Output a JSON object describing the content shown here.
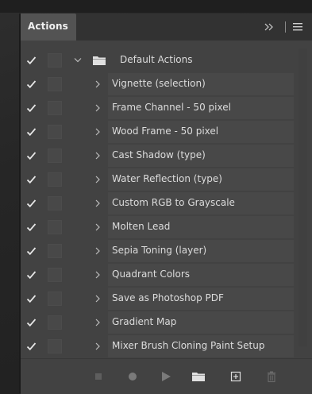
{
  "panel": {
    "tab_label": "Actions",
    "collapse_glyph": "»"
  },
  "folder": {
    "label": "Default Actions",
    "expanded": true,
    "enabled": true,
    "icon": "folder-icon"
  },
  "actions": [
    {
      "label": "Vignette (selection)",
      "enabled": true
    },
    {
      "label": "Frame Channel - 50 pixel",
      "enabled": true
    },
    {
      "label": "Wood Frame - 50 pixel",
      "enabled": true
    },
    {
      "label": "Cast Shadow (type)",
      "enabled": true
    },
    {
      "label": "Water Reflection (type)",
      "enabled": true
    },
    {
      "label": "Custom RGB to Grayscale",
      "enabled": true
    },
    {
      "label": "Molten Lead",
      "enabled": true
    },
    {
      "label": "Sepia Toning (layer)",
      "enabled": true
    },
    {
      "label": "Quadrant Colors",
      "enabled": true
    },
    {
      "label": "Save as Photoshop PDF",
      "enabled": true
    },
    {
      "label": "Gradient Map",
      "enabled": true
    },
    {
      "label": "Mixer Brush Cloning Paint Setup",
      "enabled": true
    }
  ],
  "footer_icons": [
    "stop-icon",
    "record-icon",
    "play-icon",
    "new-set-folder-icon",
    "new-action-icon",
    "trash-icon"
  ],
  "colors": {
    "panel_bg": "#424242",
    "header_bg": "#323232",
    "tab_bg": "#535353",
    "text": "#dcdcdc",
    "icon": "#c8c8c8"
  }
}
